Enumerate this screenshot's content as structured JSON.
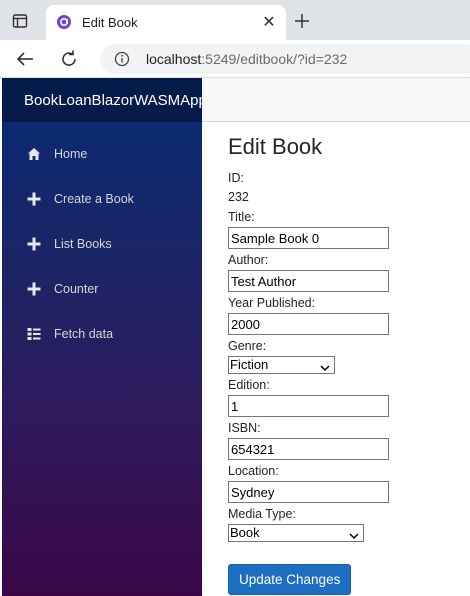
{
  "browser": {
    "tab_title": "Edit Book",
    "url_host": "localhost",
    "url_rest": ":5249/editbook/?id=232"
  },
  "app": {
    "brand": "BookLoanBlazorWASMApp",
    "nav": [
      {
        "label": "Home",
        "icon": "home-icon"
      },
      {
        "label": "Create a Book",
        "icon": "plus-icon"
      },
      {
        "label": "List Books",
        "icon": "plus-icon"
      },
      {
        "label": "Counter",
        "icon": "plus-icon"
      },
      {
        "label": "Fetch data",
        "icon": "list-icon"
      }
    ]
  },
  "form": {
    "title": "Edit Book",
    "id_label": "ID:",
    "id_value": "232",
    "title_label": "Title:",
    "title_value": "Sample Book 0",
    "author_label": "Author:",
    "author_value": "Test Author",
    "year_label": "Year Published:",
    "year_value": "2000",
    "genre_label": "Genre:",
    "genre_value": "Fiction",
    "edition_label": "Edition:",
    "edition_value": "1",
    "isbn_label": "ISBN:",
    "isbn_value": "654321",
    "location_label": "Location:",
    "location_value": "Sydney",
    "media_label": "Media Type:",
    "media_value": "Book",
    "submit_label": "Update Changes"
  },
  "colors": {
    "primary_button": "#1b6ec2",
    "sidebar_top": "#062b75",
    "sidebar_bottom": "#3a0647"
  }
}
